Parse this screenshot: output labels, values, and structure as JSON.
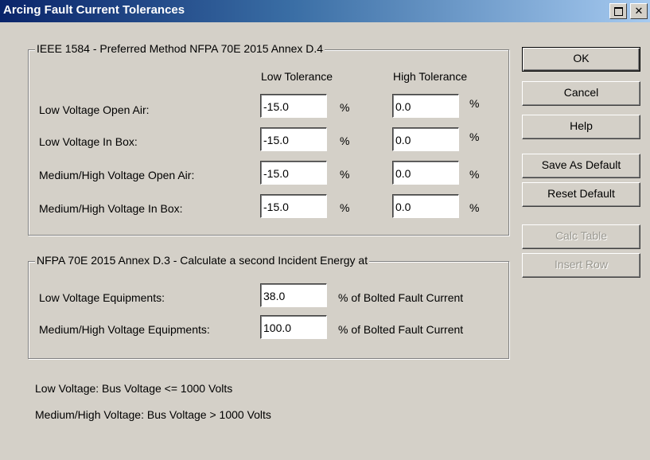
{
  "window": {
    "title": "Arcing Fault Current Tolerances"
  },
  "group1": {
    "title": "IEEE 1584 - Preferred Method NFPA 70E 2015 Annex D.4",
    "col_low": "Low Tolerance",
    "col_high": "High Tolerance",
    "rows": [
      {
        "label": "Low Voltage Open Air:",
        "low": "-15.0",
        "high": "0.0",
        "unit": "%"
      },
      {
        "label": "Low Voltage In Box:",
        "low": "-15.0",
        "high": "0.0",
        "unit": "%"
      },
      {
        "label": "Medium/High Voltage Open Air:",
        "low": "-15.0",
        "high": "0.0",
        "unit": "%"
      },
      {
        "label": "Medium/High Voltage In Box:",
        "low": "-15.0",
        "high": "0.0",
        "unit": "%"
      }
    ]
  },
  "group2": {
    "title": "NFPA 70E 2015 Annex D.3 - Calculate a second Incident Energy at",
    "rows": [
      {
        "label": "Low Voltage Equipments:",
        "value": "38.0",
        "suffix": "% of Bolted Fault Current"
      },
      {
        "label": "Medium/High Voltage Equipments:",
        "value": "100.0",
        "suffix": "% of Bolted Fault Current"
      }
    ]
  },
  "notes": [
    "Low Voltage: Bus Voltage <= 1000 Volts",
    "Medium/High Voltage: Bus Voltage > 1000 Volts"
  ],
  "buttons": {
    "ok": "OK",
    "cancel": "Cancel",
    "help": "Help",
    "save_default": "Save As Default",
    "reset_default": "Reset Default",
    "calc_table": "Calc Table",
    "insert_row": "Insert Row"
  }
}
